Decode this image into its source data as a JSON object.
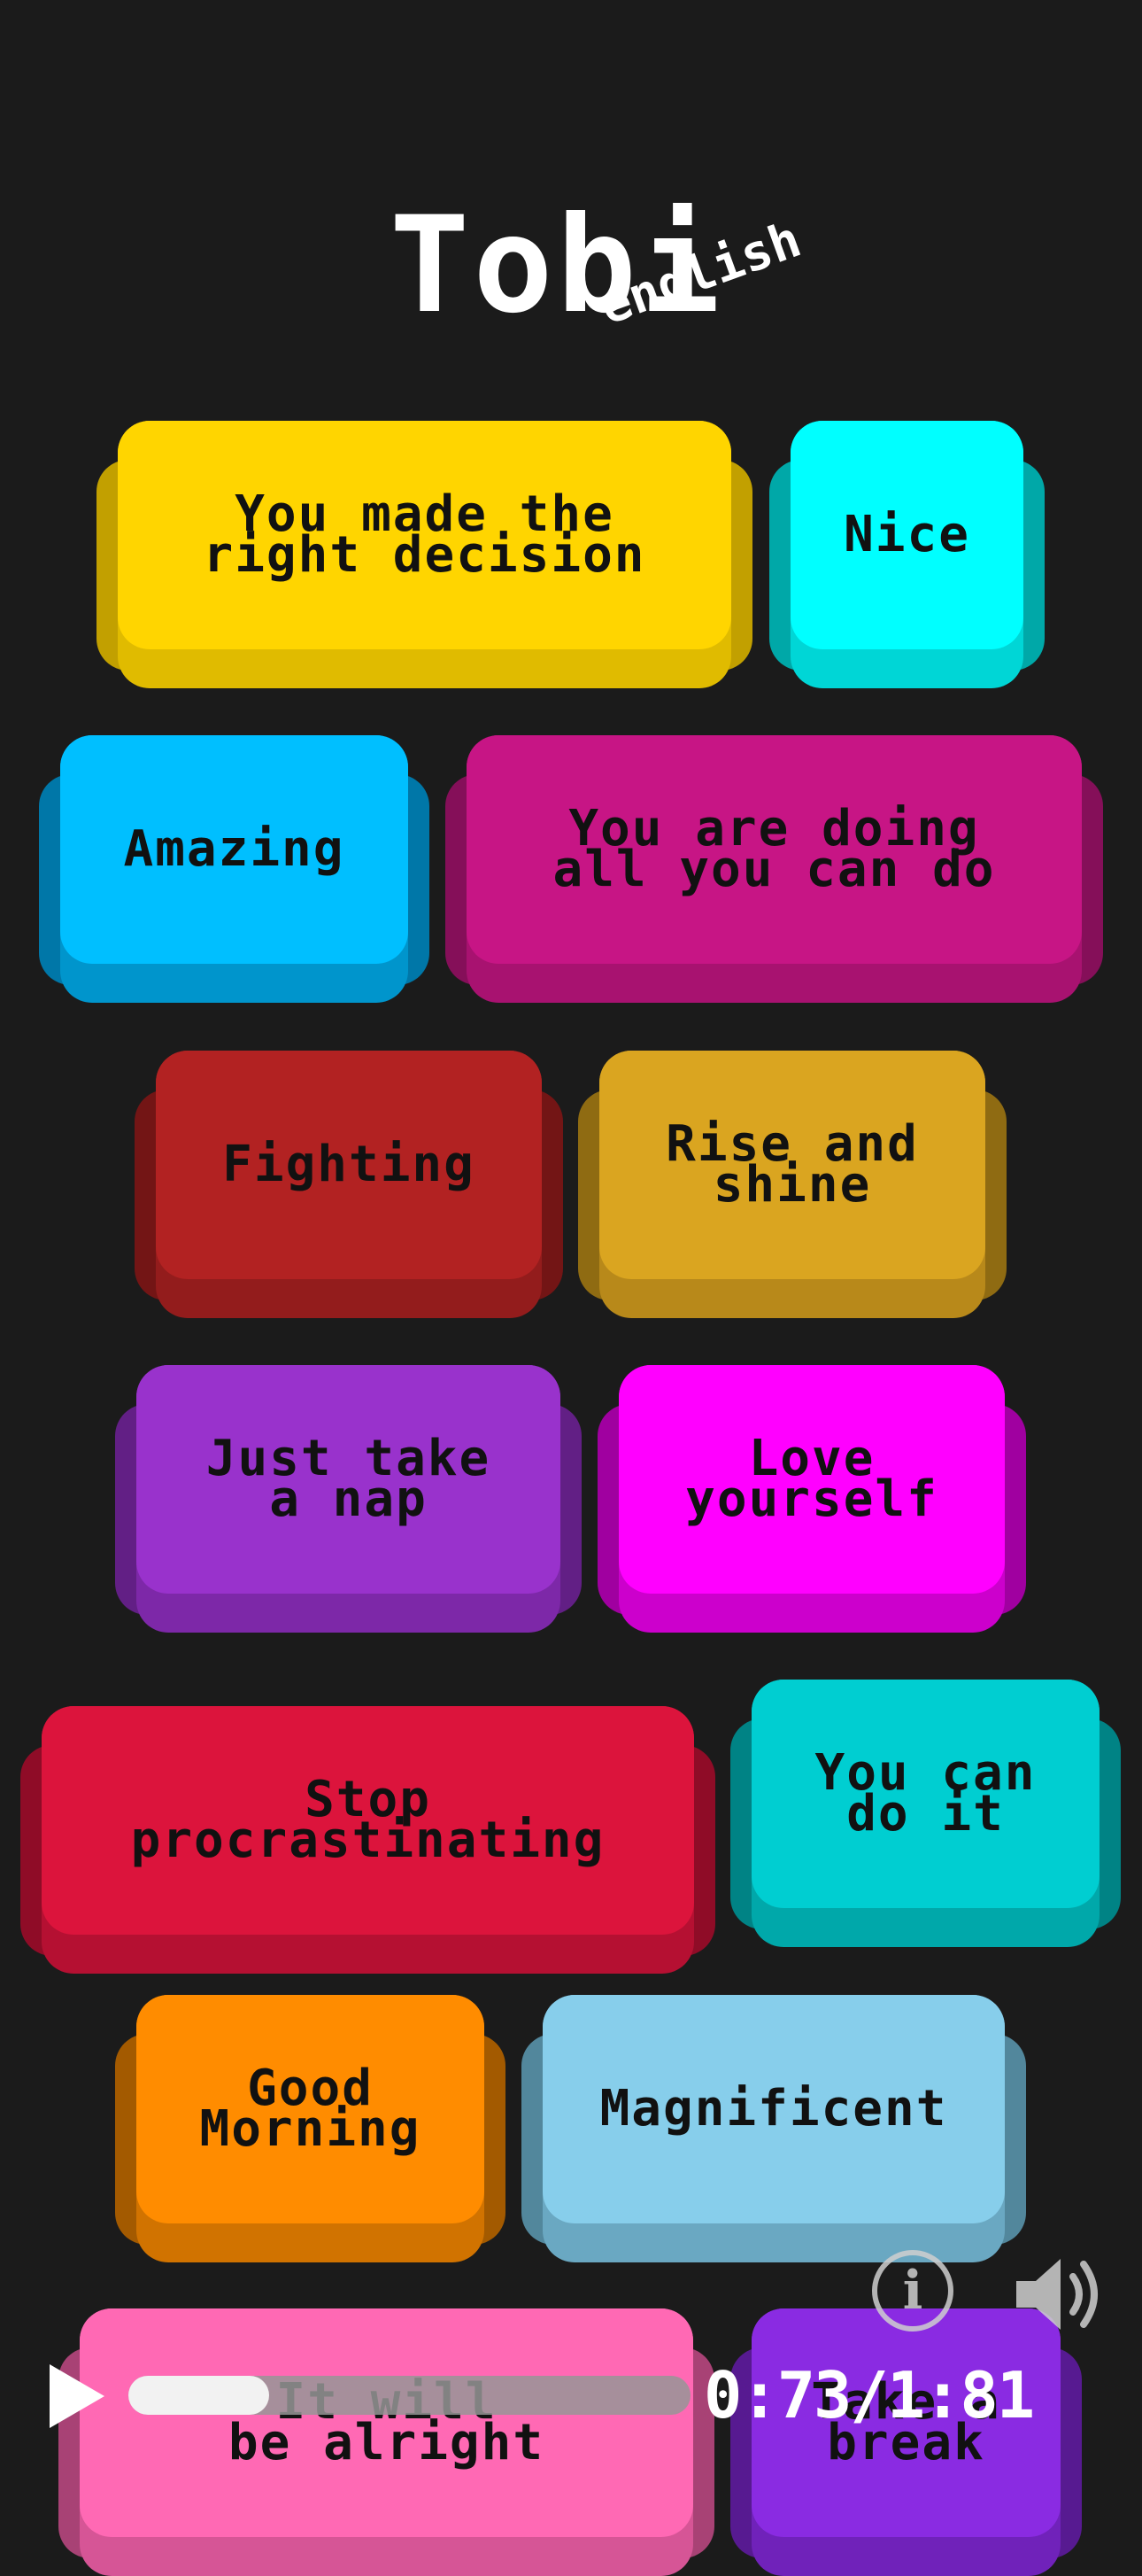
{
  "header": {
    "title": "Tobi",
    "subtitle": "english"
  },
  "buttons": [
    {
      "label": "You made the\nright decision",
      "color": "#ffd500",
      "under": "#e0bb00",
      "shadow": "#c2a000"
    },
    {
      "label": "Nice",
      "color": "#00ffff",
      "under": "#00d6d6",
      "shadow": "#00a8a8"
    },
    {
      "label": "Amazing",
      "color": "#00bfff",
      "under": "#0095cc",
      "shadow": "#0077a8"
    },
    {
      "label": "You are doing\nall you can do",
      "color": "#c71585",
      "under": "#a81270",
      "shadow": "#850f59"
    },
    {
      "label": "Fighting",
      "color": "#b22222",
      "under": "#931c1c",
      "shadow": "#731515"
    },
    {
      "label": "Rise and\nshine",
      "color": "#daa520",
      "under": "#b8891a",
      "shadow": "#8f6b12"
    },
    {
      "label": "Just take\na nap",
      "color": "#9932cc",
      "under": "#7d28a8",
      "shadow": "#621f85"
    },
    {
      "label": "Love\nyourself",
      "color": "#ff00ff",
      "under": "#cc00cc",
      "shadow": "#a000a0"
    },
    {
      "label": "Stop\nprocrastinating",
      "color": "#dc143c",
      "under": "#b51032",
      "shadow": "#8f0c27"
    },
    {
      "label": "You can\ndo it",
      "color": "#00ced1",
      "under": "#00a8aa",
      "shadow": "#008385"
    },
    {
      "label": "Good\nMorning",
      "color": "#ff8c00",
      "under": "#d17300",
      "shadow": "#a35a00"
    },
    {
      "label": "Magnificent",
      "color": "#87ceeb",
      "under": "#6aa8c2",
      "shadow": "#52879c"
    },
    {
      "label": "It will\nbe alright",
      "color": "#ff69b4",
      "under": "#d65596",
      "shadow": "#a84275"
    },
    {
      "label": "Take a\nbreak",
      "color": "#8a2be2",
      "under": "#7022ba",
      "shadow": "#571a91"
    }
  ],
  "player": {
    "time": "0:73/1:81",
    "progress": 0.25,
    "play_icon": "play-icon",
    "info_icon": "info-icon",
    "speaker_icon": "speaker-icon"
  }
}
